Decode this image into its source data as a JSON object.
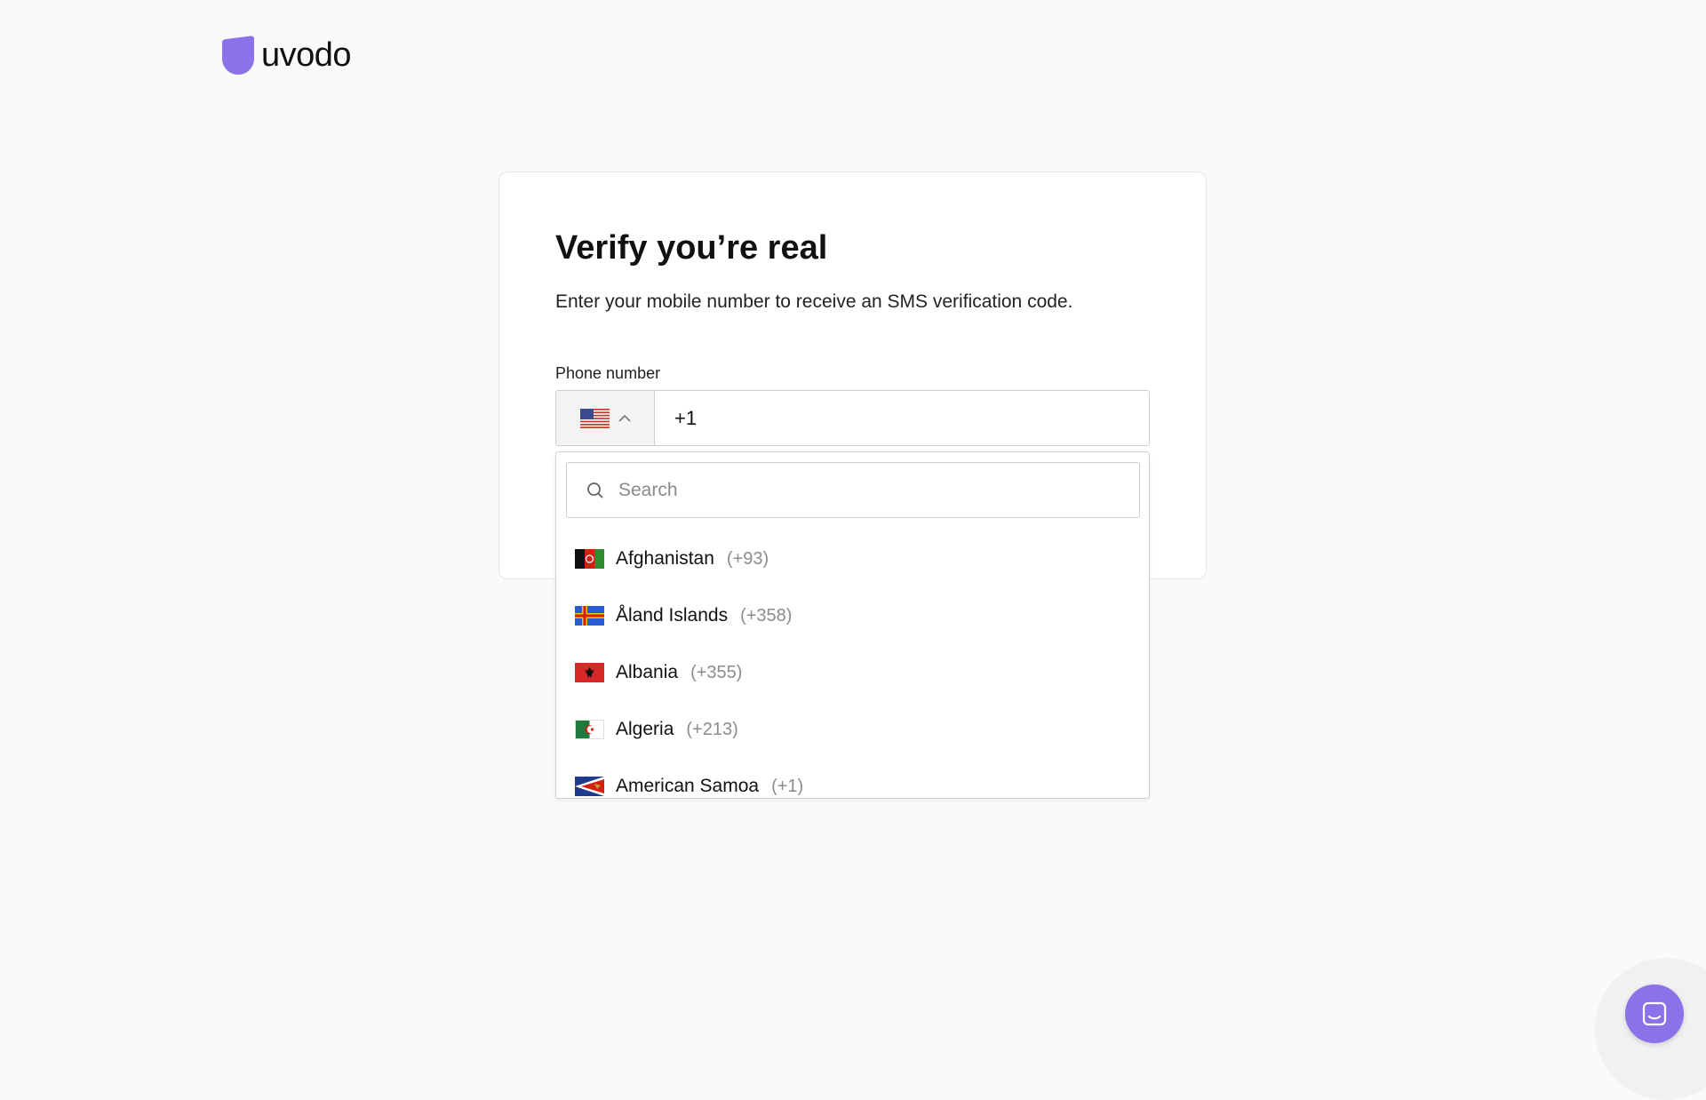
{
  "brand": {
    "name": "uvodo",
    "logo_color": "#8b72e8"
  },
  "verify": {
    "title": "Verify you’re real",
    "subtitle": "Enter your mobile number to receive an SMS verification code.",
    "phone_label": "Phone number",
    "phone_value": "+1",
    "selected_country_flag": "us-flag-icon"
  },
  "dropdown": {
    "search_placeholder": "Search",
    "countries": [
      {
        "name": "Afghanistan",
        "code": "(+93)",
        "flag": "afghanistan-flag-icon"
      },
      {
        "name": "Åland Islands",
        "code": "(+358)",
        "flag": "aland-islands-flag-icon"
      },
      {
        "name": "Albania",
        "code": "(+355)",
        "flag": "albania-flag-icon"
      },
      {
        "name": "Algeria",
        "code": "(+213)",
        "flag": "algeria-flag-icon"
      },
      {
        "name": "American Samoa",
        "code": "(+1)",
        "flag": "american-samoa-flag-icon"
      }
    ]
  },
  "chat": {
    "icon": "chat-icon",
    "color": "#8b72e8"
  }
}
